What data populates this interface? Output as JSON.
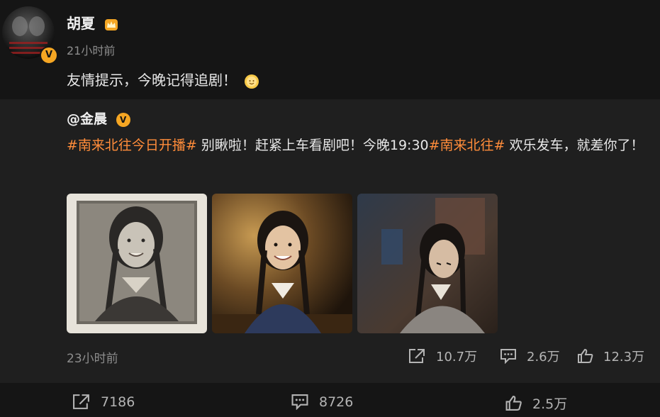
{
  "author": {
    "name": "胡夏",
    "time": "21小时前",
    "text": "友情提示，今晚记得追剧！",
    "verified_badge": "V"
  },
  "repost": {
    "author": "@金晨",
    "verified_badge": "V",
    "text_parts": {
      "tag1": "#南来北往今日开播#",
      "plain1": " 别瞅啦！赶紧上车看剧吧！今晚19:30",
      "tag2": "#南来北往#",
      "plain2": " 欢乐发车，就差你了！"
    },
    "time": "23小时前",
    "actions": {
      "share": "10.7万",
      "comment": "2.6万",
      "like": "12.3万"
    },
    "images": [
      "vintage-photo",
      "smiling-girl-in-train",
      "girl-reading"
    ]
  },
  "footer_actions": {
    "share": "7186",
    "comment": "8726",
    "like": "2.5万"
  },
  "colors": {
    "background": "#151515",
    "repost_background": "#1f1f1f",
    "hashtag": "#ff8c3a",
    "badge": "#f5a623"
  }
}
